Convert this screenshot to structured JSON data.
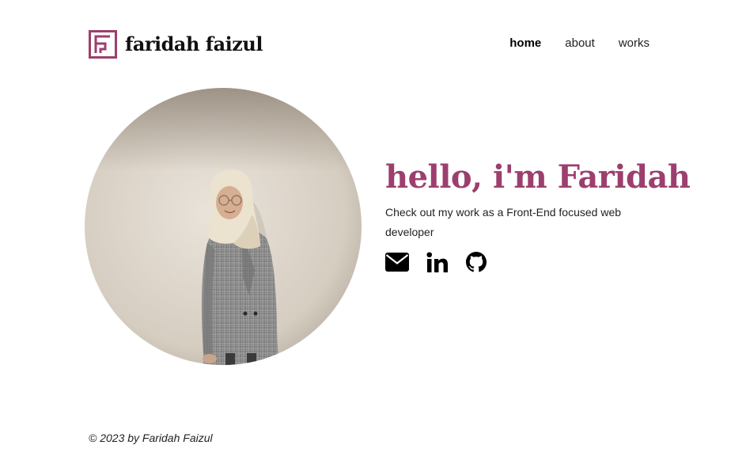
{
  "site": {
    "logo_text": "faridah faizul",
    "logo_icon": "logo-f-icon",
    "brand_color": "#9c3f6e"
  },
  "nav": {
    "items": [
      {
        "label": "home",
        "active": true
      },
      {
        "label": "about",
        "active": false
      },
      {
        "label": "works",
        "active": false
      }
    ]
  },
  "hero": {
    "headline": "hello, i'm Faridah",
    "tagline": "Check out my work as a Front-End focused web developer",
    "social": [
      {
        "icon": "envelope-icon"
      },
      {
        "icon": "linkedin-icon"
      },
      {
        "icon": "github-icon"
      }
    ]
  },
  "footer": {
    "copyright": "© 2023 by Faridah Faizul"
  }
}
